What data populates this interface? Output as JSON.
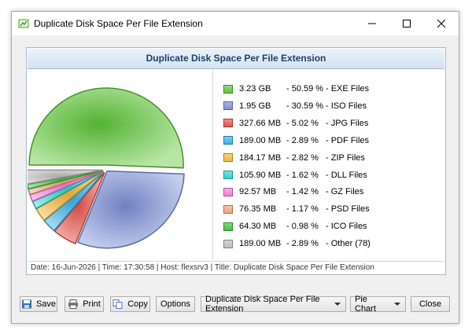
{
  "window": {
    "title": "Duplicate Disk Space Per File Extension"
  },
  "chart_data": {
    "type": "pie",
    "title": "Duplicate Disk Space Per File Extension",
    "slices": [
      {
        "size": "3.23 GB",
        "percent": "50.59 %",
        "label": "EXE Files",
        "value": 50.59,
        "color": "#5cc635"
      },
      {
        "size": "1.95 GB",
        "percent": "30.59 %",
        "label": "ISO Files",
        "value": 30.59,
        "color": "#7b8fd8"
      },
      {
        "size": "327.66 MB",
        "percent": "5.02 %",
        "label": "JPG Files",
        "value": 5.02,
        "color": "#e8524a"
      },
      {
        "size": "189.00 MB",
        "percent": "2.89 %",
        "label": "PDF Files",
        "value": 2.89,
        "color": "#39b2ea"
      },
      {
        "size": "184.17 MB",
        "percent": "2.82 %",
        "label": "ZIP Files",
        "value": 2.82,
        "color": "#f2b83c"
      },
      {
        "size": "105.90 MB",
        "percent": "1.62 %",
        "label": "DLL Files",
        "value": 1.62,
        "color": "#2fd4d0"
      },
      {
        "size": "92.57 MB",
        "percent": "1.42 %",
        "label": "GZ Files",
        "value": 1.42,
        "color": "#f37de4"
      },
      {
        "size": "76.35 MB",
        "percent": "1.17 %",
        "label": "PSD Files",
        "value": 1.17,
        "color": "#f4a07c"
      },
      {
        "size": "64.30 MB",
        "percent": "0.98 %",
        "label": "ICO Files",
        "value": 0.98,
        "color": "#43c240"
      },
      {
        "size": "189.00 MB",
        "percent": "2.89 %",
        "label": "Other (78)",
        "value": 2.89,
        "color": "#bdbdbd"
      }
    ]
  },
  "status": "Date: 16-Jun-2026 | Time: 17:30:58 | Host: flexsrv3 | Title: Duplicate Disk Space Per File Extension",
  "buttons": {
    "save": "Save",
    "print": "Print",
    "copy": "Copy",
    "options": "Options",
    "close": "Close"
  },
  "combos": {
    "report": "Duplicate Disk Space Per File Extension",
    "chart_type": "Pie Chart"
  }
}
